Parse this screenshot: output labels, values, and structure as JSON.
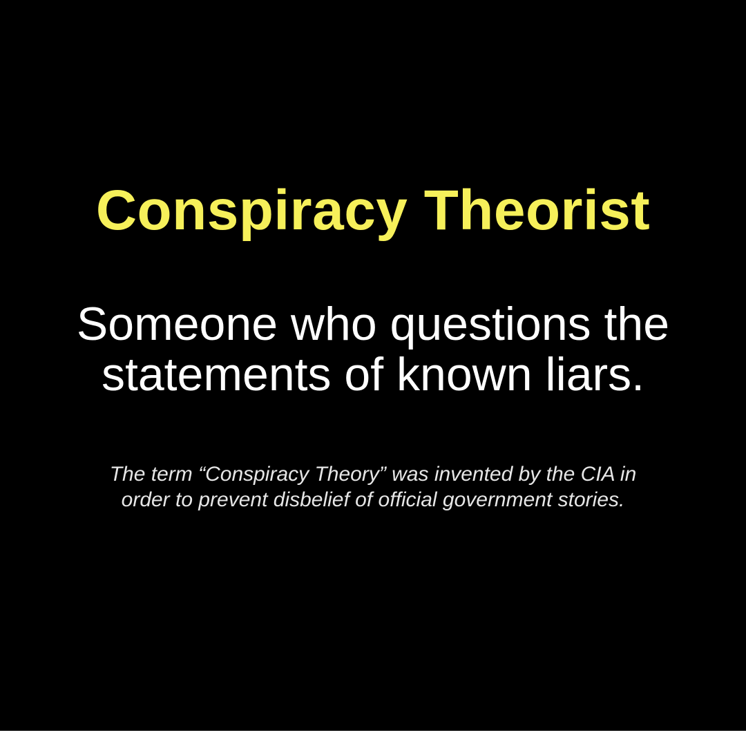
{
  "colors": {
    "background": "#000000",
    "title": "#f6f05a",
    "definition": "#ffffff",
    "footnote": "#e6e6e6"
  },
  "poster": {
    "title": "Conspiracy Theorist",
    "definition": {
      "line1": "Someone who questions the",
      "line2": "statements of known liars."
    },
    "footnote": {
      "line1": "The term “Conspiracy Theory” was invented by the CIA in",
      "line2": "order to prevent disbelief of official government stories."
    }
  }
}
